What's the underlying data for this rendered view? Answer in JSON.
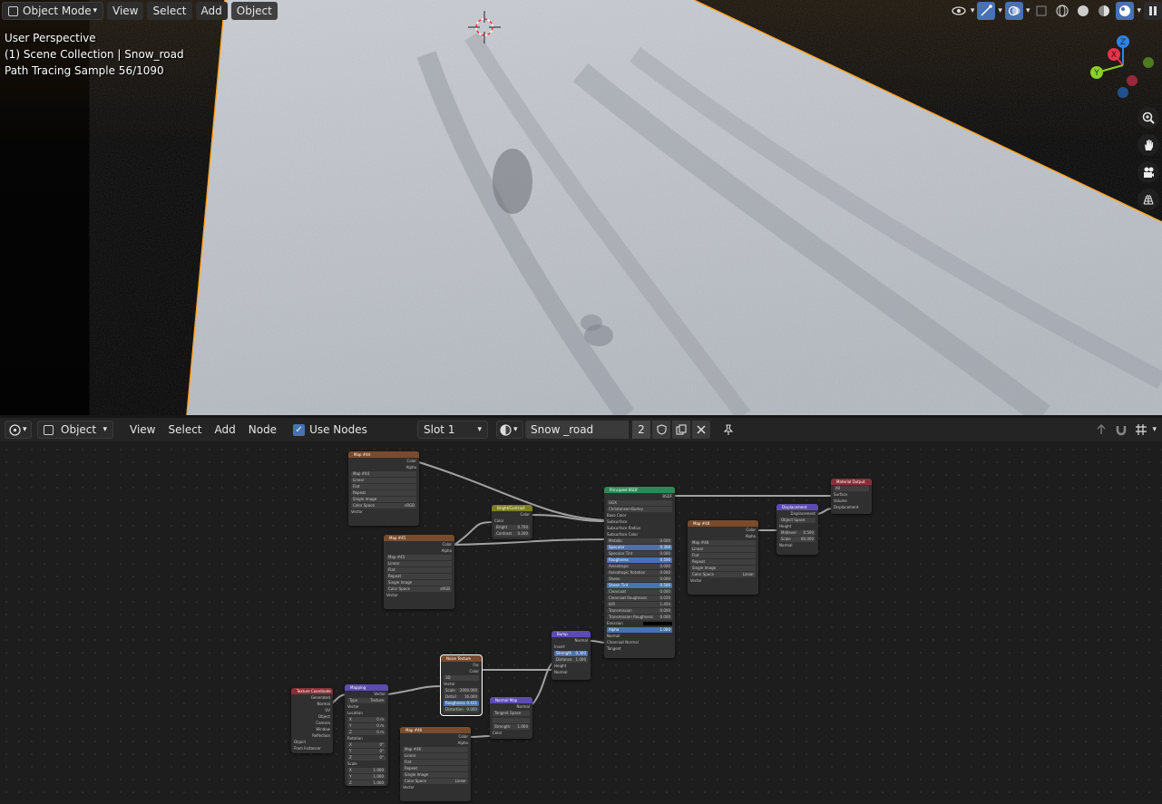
{
  "viewport": {
    "mode_label": "Object Mode",
    "menus": [
      "View",
      "Select",
      "Add",
      "Object"
    ],
    "info_lines": [
      "User Perspective",
      "(1) Scene Collection | Snow_road",
      "Path Tracing Sample 56/1090"
    ],
    "gizmo_labels": {
      "x": "X",
      "y": "Y",
      "z": "Z"
    }
  },
  "node_editor": {
    "type_label": "Object",
    "menus": [
      "View",
      "Select",
      "Add",
      "Node"
    ],
    "use_nodes_label": "Use Nodes",
    "slot_label": "Slot 1",
    "material_name": "Snow _road",
    "user_count": "2"
  },
  "nodes": {
    "map_a": {
      "title": "Map #44",
      "rows": [
        "Color",
        "Alpha",
        "Map #44",
        "Linear",
        "Flat",
        "Repeat",
        "Single Image",
        "Color Space",
        "sRGB",
        "Vector"
      ]
    },
    "bright": {
      "title": "Bright/Contrast",
      "rows": [
        "Color",
        "Color",
        "Bright",
        "0.700",
        "Contrast",
        "0.200"
      ]
    },
    "map_b": {
      "title": "Map #45",
      "rows": [
        "Color",
        "Alpha",
        "Map #45",
        "Linear",
        "Flat",
        "Repeat",
        "Single Image",
        "Color Space",
        "sRGB",
        "Vector"
      ]
    },
    "principled": {
      "title": "Principled BSDF",
      "out": "BSDF",
      "selects": [
        "GGX",
        "Christensen-Burley"
      ],
      "rows": [
        [
          "Base Color",
          ""
        ],
        [
          "Subsurface",
          ""
        ],
        [
          "Subsurface Radius",
          ""
        ],
        [
          "Subsurface Color",
          ""
        ],
        [
          "Metallic",
          "0.000"
        ],
        [
          "Specular",
          "0.368"
        ],
        [
          "Specular Tint",
          "0.000"
        ],
        [
          "Roughness",
          "0.500"
        ],
        [
          "Anisotropic",
          "0.000"
        ],
        [
          "Anisotropic Rotation",
          "0.000"
        ],
        [
          "Sheen",
          "0.000"
        ],
        [
          "Sheen Tint",
          "0.500"
        ],
        [
          "Clearcoat",
          "0.000"
        ],
        [
          "Clearcoat Roughness",
          "0.030"
        ],
        [
          "IOR",
          "1.450"
        ],
        [
          "Transmission",
          "0.000"
        ],
        [
          "Transmission Roughness",
          "0.000"
        ],
        [
          "Emission",
          ""
        ],
        [
          "Alpha",
          "1.000"
        ],
        [
          "Normal",
          ""
        ],
        [
          "Clearcoat Normal",
          ""
        ],
        [
          "Tangent",
          ""
        ]
      ]
    },
    "map_c": {
      "title": "Map #48",
      "rows": [
        "Color",
        "Alpha",
        "Map #48",
        "Linear",
        "Flat",
        "Repeat",
        "Single Image",
        "Color Space",
        "Linear",
        "Vector"
      ]
    },
    "displacement": {
      "title": "Displacement",
      "rows": [
        "Displacement",
        "Object Space",
        "Height",
        "Midlevel",
        "0.500",
        "Scale",
        "60.000",
        "Normal"
      ]
    },
    "output": {
      "title": "Material Output",
      "rows": [
        "All",
        "Surface",
        "Volume",
        "Displacement"
      ]
    },
    "bump": {
      "title": "Bump",
      "rows": [
        "Normal",
        "Invert",
        "Strength",
        "0.300",
        "Distance",
        "1.000",
        "Height",
        "Normal"
      ]
    },
    "noise": {
      "title": "Noise Texture",
      "rows": [
        "Fac",
        "Color",
        "3D",
        "Vector",
        "Scale",
        "2000.000",
        "Detail",
        "16.000",
        "Roughness",
        "0.431",
        "Distortion",
        "0.000"
      ]
    },
    "texcoord": {
      "title": "Texture Coordinate",
      "rows": [
        "Generated",
        "Normal",
        "UV",
        "Object",
        "Camera",
        "Window",
        "Reflection",
        "Object",
        "From Instancer"
      ]
    },
    "mapping": {
      "title": "Mapping",
      "rows": [
        "Vector",
        "Type",
        "Texture",
        "Vector",
        "Location",
        "X",
        "0 m",
        "Y",
        "0 m",
        "Z",
        "0 m",
        "Rotation",
        "X",
        "0°",
        "Y",
        "0°",
        "Z",
        "0°",
        "Scale",
        "X",
        "1.000",
        "Y",
        "1.000",
        "Z",
        "1.000"
      ]
    },
    "normalmap": {
      "title": "Normal Map",
      "rows": [
        "Normal",
        "Tangent Space",
        "Strength",
        "1.000",
        "Color"
      ]
    },
    "map_d": {
      "title": "Map #46",
      "rows": [
        "Color",
        "Alpha",
        "Map #46",
        "Linear",
        "Flat",
        "Repeat",
        "Single Image",
        "Color Space",
        "Linear",
        "Vector"
      ]
    }
  },
  "colors": {
    "accent": "#4772b3",
    "selection": "#ffa62b",
    "background": "#1d1d1d"
  }
}
